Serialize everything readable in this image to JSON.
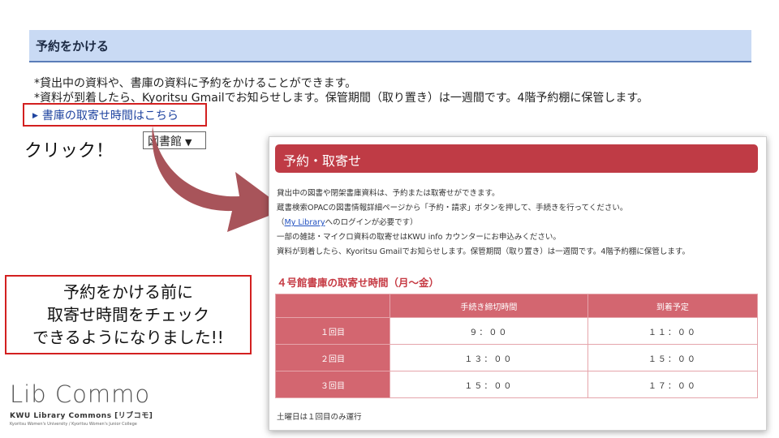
{
  "background_page": {
    "header_title": "予約をかける",
    "line1": "*貸出中の資料や、書庫の資料に予約をかけることができます。",
    "line2": "*資料が到着したら、Kyoritsu Gmailでお知らせします。保管期間（取り置き）は一週間です。4階予約棚に保管します。",
    "link_text": "書庫の取寄せ時間はこちら",
    "select_value": "図書館"
  },
  "annotation": {
    "click_label": "クリック！",
    "callout_lines": [
      "予約をかける前に",
      "取寄せ時間をチェック",
      "できるようになりました!!"
    ],
    "arrow_color": "#a8545a"
  },
  "logo": {
    "main": "Lib Commo",
    "sub": "KWU Library Commons [リブコモ]",
    "tiny": "Kyoritsu Women's University / Kyoritsu Women's Junior College"
  },
  "panel": {
    "title": "予約・取寄せ",
    "intro": [
      "貸出中の図書や閉架書庫資料は、予約または取寄せができます。",
      "蔵書検索OPACの図書情報詳細ページから「予約・請求」ボタンを押して、手続きを行ってください。",
      "一部の雑誌・マイクロ資料の取寄せはKWU info カウンターにお申込みください。",
      "資料が到着したら、Kyoritsu Gmailでお知らせします。保管期間（取り置き）は一週間です。4階予約棚に保管します。"
    ],
    "login_note_prefix": "（",
    "login_link": "My Library",
    "login_note_suffix": "へのログインが必要です）",
    "schedule_title": "４号館書庫の取寄せ時間（月～金）",
    "table": {
      "headers": [
        "手続き締切時間",
        "到着予定"
      ],
      "rows": [
        {
          "label": "１回目",
          "deadline": "９：００",
          "arrival": "１１：００"
        },
        {
          "label": "２回目",
          "deadline": "１３：００",
          "arrival": "１５：００"
        },
        {
          "label": "３回目",
          "deadline": "１５：００",
          "arrival": "１７：００"
        }
      ]
    },
    "footnote": "土曜日は１回目のみ運行"
  },
  "colors": {
    "panel_header": "#bf3b45",
    "table_header": "#d36670",
    "highlight_border": "#d32020",
    "bg_header": "#c9daf4"
  }
}
